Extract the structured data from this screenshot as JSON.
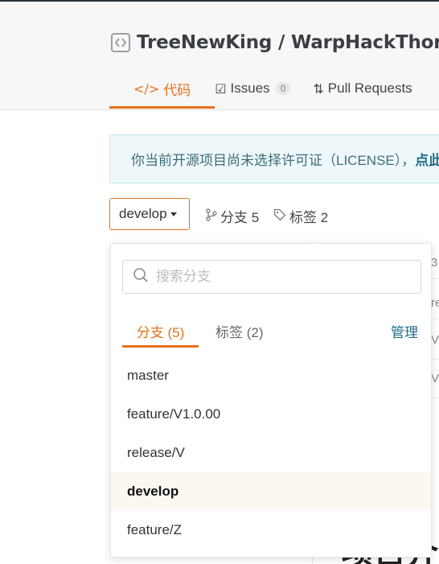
{
  "repo": {
    "owner": "TreeNewKing",
    "separator": "/",
    "name": "WarpHackThon"
  },
  "tabs": [
    {
      "icon": "</>",
      "label": "代码"
    },
    {
      "icon": "☑",
      "label": "Issues",
      "count": "0"
    },
    {
      "icon": "⇅",
      "label": "Pull Requests"
    }
  ],
  "license_notice": {
    "text": "你当前开源项目尚未选择许可证（LICENSE），",
    "link": "点此选择"
  },
  "branch_selector": {
    "current": "develop"
  },
  "meta": {
    "branches_label": "分支 5",
    "tags_label": "标签 2"
  },
  "dropdown": {
    "search_placeholder": "搜索分支",
    "tab_branches": "分支 (5)",
    "tab_tags": "标签 (2)",
    "manage": "管理",
    "items": [
      "master",
      "feature/V1.0.00",
      "release/V",
      "develop",
      "feature/Z"
    ]
  },
  "background": {
    "glimpses": [
      "3",
      "re",
      "V",
      "V"
    ],
    "heading_fragment": "项目介"
  },
  "colors": {
    "accent": "#e5711c",
    "link": "#1f6f86",
    "notice_bg": "#eef8fa"
  }
}
